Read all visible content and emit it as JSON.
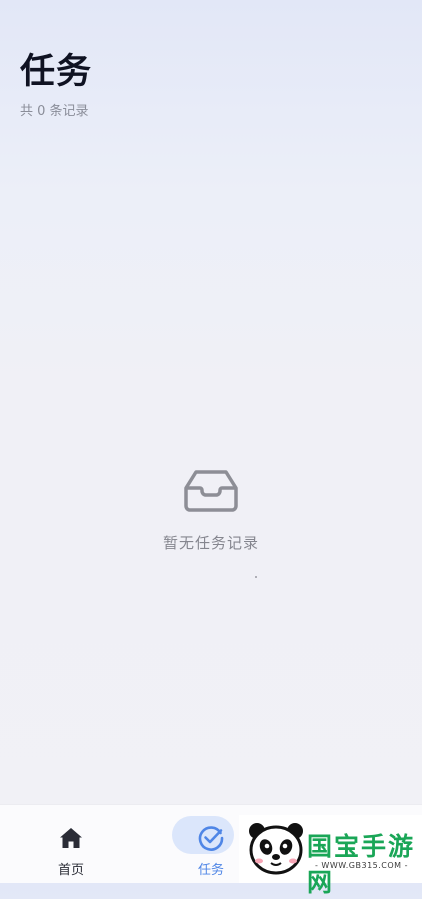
{
  "header": {
    "title": "任务",
    "record_count": "共 0 条记录"
  },
  "empty_state": {
    "icon": "inbox-icon",
    "message": "暂无任务记录"
  },
  "tabbar": {
    "items": [
      {
        "label": "首页",
        "icon": "home-icon",
        "active": false
      },
      {
        "label": "任务",
        "icon": "check-circle-icon",
        "active": true
      }
    ]
  },
  "watermark": {
    "title": "国宝手游网",
    "url": "- WWW.GB315.COM -"
  },
  "colors": {
    "accent": "#4f86e6",
    "active_pill": "#dbe6fb",
    "watermark_green": "#1aa657"
  }
}
